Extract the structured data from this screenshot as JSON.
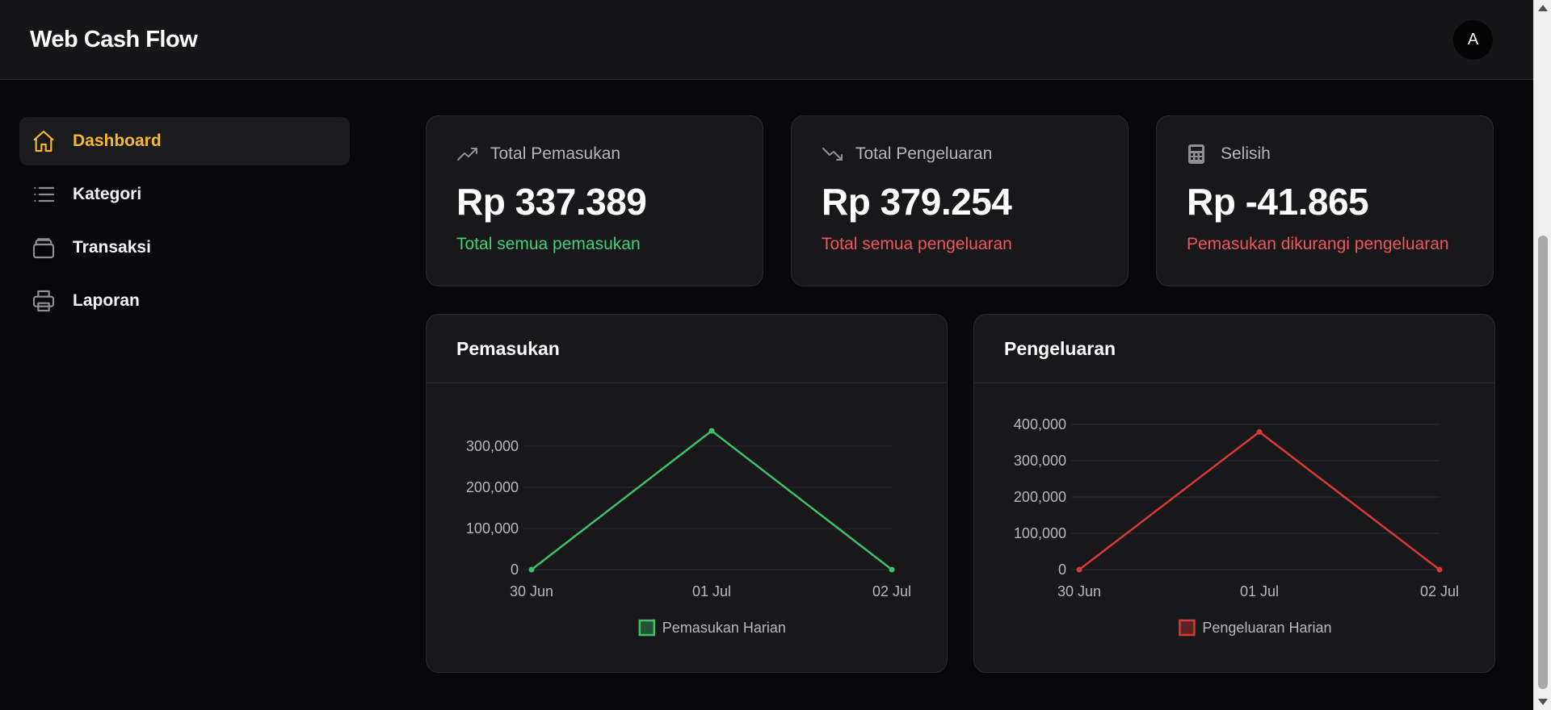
{
  "header": {
    "brand": "Web Cash Flow",
    "avatar_initial": "A"
  },
  "sidebar": {
    "items": [
      {
        "label": "Dashboard",
        "icon": "home-icon",
        "active": true
      },
      {
        "label": "Kategori",
        "icon": "list-icon",
        "active": false
      },
      {
        "label": "Transaksi",
        "icon": "wallet-icon",
        "active": false
      },
      {
        "label": "Laporan",
        "icon": "printer-icon",
        "active": false
      }
    ]
  },
  "stats": [
    {
      "label": "Total Pemasukan",
      "icon": "trending-up-icon",
      "value": "Rp 337.389",
      "subtitle": "Total semua pemasukan",
      "subtitle_color": "#3fd27a"
    },
    {
      "label": "Total Pengeluaran",
      "icon": "trending-down-icon",
      "value": "Rp 379.254",
      "subtitle": "Total semua pengeluaran",
      "subtitle_color": "#f0565b"
    },
    {
      "label": "Selisih",
      "icon": "calculator-icon",
      "value": "Rp -41.865",
      "subtitle": "Pemasukan dikurangi pengeluaran",
      "subtitle_color": "#f0565b"
    }
  ],
  "charts": {
    "income": {
      "title": "Pemasukan"
    },
    "expense": {
      "title": "Pengeluaran"
    }
  },
  "chart_data": [
    {
      "type": "line",
      "title": "Pemasukan",
      "x": [
        "30 Jun",
        "01 Jul",
        "02 Jul"
      ],
      "series": [
        {
          "name": "Pemasukan Harian",
          "values": [
            0,
            337389,
            0
          ],
          "color": "#3fbf6a"
        }
      ],
      "yticks": [
        0,
        100000,
        200000,
        300000
      ],
      "ytick_labels": [
        "0",
        "100,000",
        "200,000",
        "300,000"
      ],
      "ylim": [
        0,
        337389
      ],
      "grid": true,
      "legend": "bottom"
    },
    {
      "type": "line",
      "title": "Pengeluaran",
      "x": [
        "30 Jun",
        "01 Jul",
        "02 Jul"
      ],
      "series": [
        {
          "name": "Pengeluaran Harian",
          "values": [
            0,
            379254,
            0
          ],
          "color": "#d63a3a"
        }
      ],
      "yticks": [
        0,
        100000,
        200000,
        300000,
        400000
      ],
      "ytick_labels": [
        "0",
        "100,000",
        "200,000",
        "300,000",
        "400,000"
      ],
      "ylim": [
        0,
        400000
      ],
      "grid": true,
      "legend": "bottom"
    }
  ]
}
